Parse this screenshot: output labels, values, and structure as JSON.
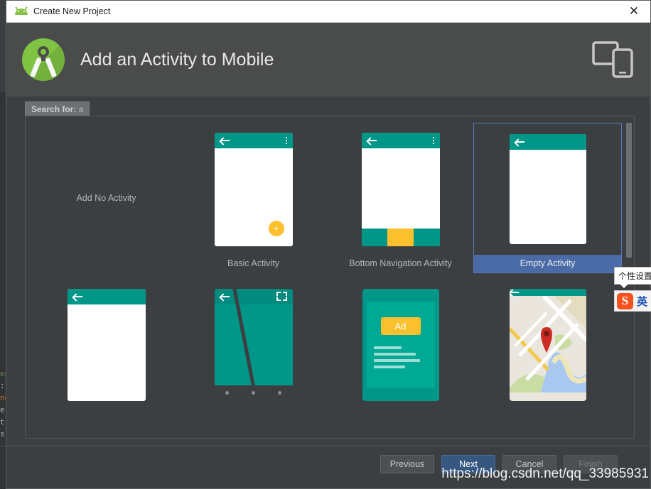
{
  "window": {
    "title": "Create New Project",
    "app_icon": "android-robot-icon",
    "close_label": "✕"
  },
  "header": {
    "title": "Add an Activity to Mobile",
    "logo": "android-studio-logo",
    "device_icon": "tablet-and-phone-icon"
  },
  "search": {
    "label": "Search for:",
    "value": "a"
  },
  "templates": {
    "row1": [
      {
        "id": "no-activity",
        "label": "Add No Activity",
        "thumb": "none",
        "selected": false
      },
      {
        "id": "basic-activity",
        "label": "Basic Activity",
        "thumb": "basic",
        "selected": false
      },
      {
        "id": "bottom-navigation-activity",
        "label": "Bottom Navigation Activity",
        "thumb": "bottomnav",
        "selected": false
      },
      {
        "id": "empty-activity",
        "label": "Empty Activity",
        "thumb": "empty",
        "selected": true
      }
    ],
    "row2": [
      {
        "id": "fullscreen-left",
        "label": "",
        "thumb": "plain"
      },
      {
        "id": "fullscreen-activity",
        "label": "",
        "thumb": "fullscreen"
      },
      {
        "id": "admob-ads-activity",
        "label": "",
        "thumb": "ad",
        "badge": "Ad"
      },
      {
        "id": "google-maps-activity",
        "label": "",
        "thumb": "map"
      }
    ]
  },
  "footer": {
    "previous": "Previous",
    "next": "Next",
    "cancel": "Cancel",
    "finish": "Finish",
    "watermark": "https://blog.csdn.net/qq_33985931"
  },
  "ime": {
    "tooltip": "个性设置",
    "logo": "S",
    "mode": "英"
  },
  "background_code": {
    "lines": [
      "ec",
      ":\\",
      "nd",
      "e",
      "t",
      "s"
    ]
  },
  "colors": {
    "accent_teal": "#009688",
    "accent_yellow": "#fbc02d",
    "selection_blue": "#4a6ba5",
    "dialog_bg": "#3c3f41",
    "header_bg": "#4a4c4c"
  }
}
